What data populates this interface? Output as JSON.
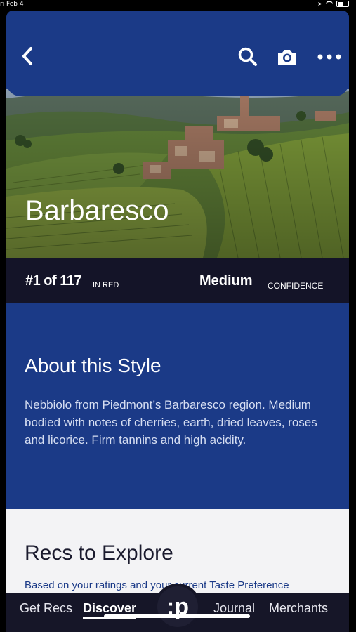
{
  "status": {
    "time": "ri Feb 4"
  },
  "hero": {
    "title": "Barbaresco"
  },
  "rank": {
    "position": "#1 of 117",
    "category": "IN RED"
  },
  "confidence": {
    "level": "Medium",
    "label": "CONFIDENCE"
  },
  "about": {
    "title": "About this Style",
    "body": "Nebbiolo from Piedmont’s Barbaresco region. Medium bodied with notes of cherries, earth, dried leaves, roses and licorice. Firm tannins and high acidity."
  },
  "recs": {
    "title": "Recs to Explore",
    "subtitle": "Based on your ratings and your current Taste Preference"
  },
  "tabs": {
    "get_recs": "Get Recs",
    "discover": "Discover",
    "center": ":p",
    "journal": "Journal",
    "merchants": "Merchants"
  },
  "colors": {
    "brand_blue": "#1b3a87",
    "dark_bar": "#141428",
    "tab_bg": "#161628"
  },
  "icons": [
    "back-arrow-icon",
    "search-icon",
    "camera-icon",
    "more-icon",
    "wifi-icon",
    "battery-icon",
    "location-icon"
  ]
}
